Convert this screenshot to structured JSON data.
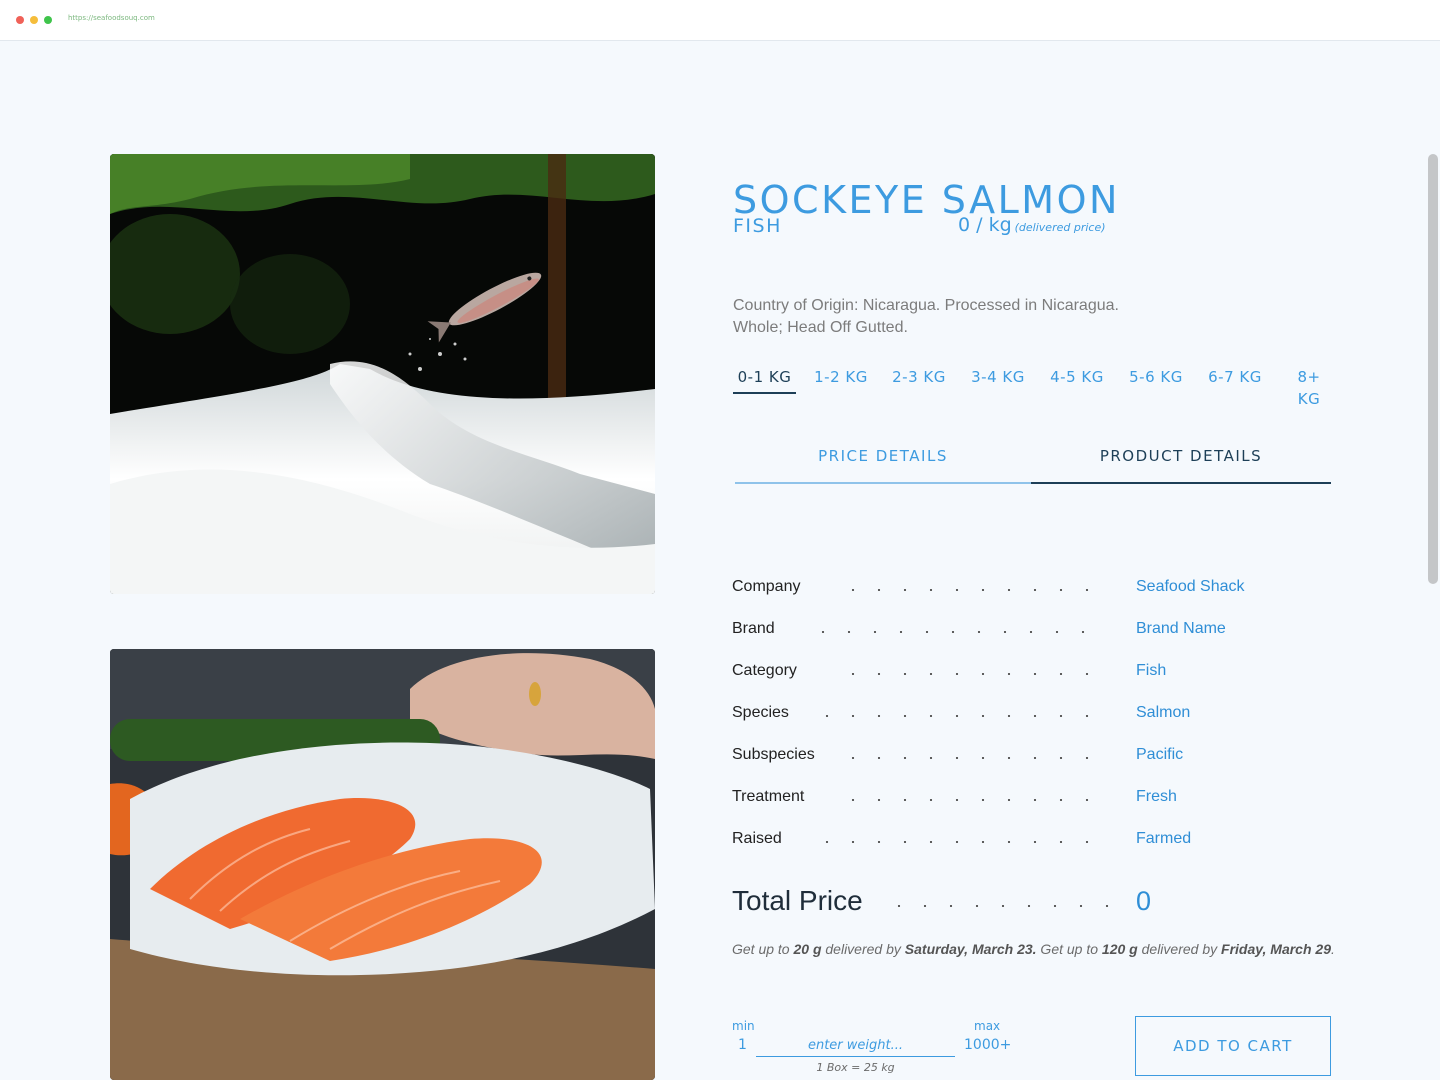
{
  "browser": {
    "url": "https://seafoodsouq.com"
  },
  "product": {
    "title": "SOCKEYE SALMON",
    "category_label": "FISH",
    "unit_price": "0 / kg",
    "unit_price_note": "(delivered price)",
    "origin_line": "Country of Origin: Nicaragua. Processed in Nicaragua.",
    "processing_line": "Whole; Head Off Gutted."
  },
  "weight_ranges": [
    {
      "label": "0-1 KG",
      "active": true
    },
    {
      "label": "1-2 KG",
      "active": false
    },
    {
      "label": "2-3 KG",
      "active": false
    },
    {
      "label": "3-4 KG",
      "active": false
    },
    {
      "label": "4-5 KG",
      "active": false
    },
    {
      "label": "5-6 KG",
      "active": false
    },
    {
      "label": "6-7 KG",
      "active": false
    },
    {
      "label": "8+ KG",
      "active": false
    }
  ],
  "tabs": [
    {
      "label": "PRICE DETAILS",
      "active": false
    },
    {
      "label": "PRODUCT DETAILS",
      "active": true
    }
  ],
  "details": [
    {
      "label": "Company",
      "value": "Seafood Shack"
    },
    {
      "label": "Brand",
      "value": "Brand Name"
    },
    {
      "label": "Category",
      "value": "Fish"
    },
    {
      "label": "Species",
      "value": "Salmon"
    },
    {
      "label": "Subspecies",
      "value": "Pacific"
    },
    {
      "label": "Treatment",
      "value": "Fresh"
    },
    {
      "label": "Raised",
      "value": "Farmed"
    }
  ],
  "total": {
    "label": "Total Price",
    "value": "0"
  },
  "delivery": {
    "t1": "Get up to ",
    "amount1": "20 g",
    "t2": " delivered by ",
    "date1": "Saturday, March 23.",
    "t3": " Get up to ",
    "amount2": "120 g",
    "t4": " delivered by ",
    "date2": "Friday, March 29",
    "t5": "."
  },
  "order": {
    "min_label": "min",
    "min_value": "1",
    "max_label": "max",
    "max_value": "1000+",
    "weight_placeholder": "enter weight...",
    "box_note": "1 Box = 25 kg",
    "add_to_cart": "ADD TO CART"
  },
  "colors": {
    "accent": "#3d9be0",
    "dark": "#1d3f57",
    "background": "#f5f9fd"
  }
}
